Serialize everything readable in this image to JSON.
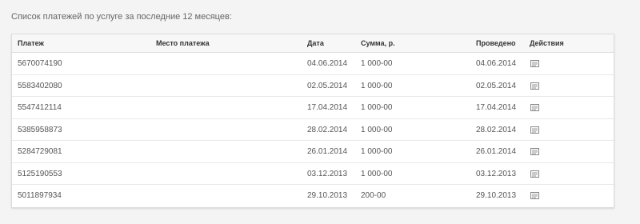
{
  "caption": "Список платежей по услуге за последние 12 месяцев:",
  "table": {
    "headers": {
      "payment": "Платеж",
      "place": "Место платежа",
      "date": "Дата",
      "sum": "Сумма, р.",
      "done": "Проведено",
      "actions": "Действия"
    },
    "rows": [
      {
        "payment": "5670074190",
        "place": "",
        "date": "04.06.2014",
        "sum": "1 000-00",
        "done": "04.06.2014",
        "action_icon": "receipt-icon"
      },
      {
        "payment": "5583402080",
        "place": "",
        "date": "02.05.2014",
        "sum": "1 000-00",
        "done": "02.05.2014",
        "action_icon": "receipt-icon"
      },
      {
        "payment": "5547412114",
        "place": "",
        "date": "17.04.2014",
        "sum": "1 000-00",
        "done": "17.04.2014",
        "action_icon": "receipt-icon"
      },
      {
        "payment": "5385958873",
        "place": "",
        "date": "28.02.2014",
        "sum": "1 000-00",
        "done": "28.02.2014",
        "action_icon": "receipt-icon"
      },
      {
        "payment": "5284729081",
        "place": "",
        "date": "26.01.2014",
        "sum": "1 000-00",
        "done": "26.01.2014",
        "action_icon": "receipt-icon"
      },
      {
        "payment": "5125190553",
        "place": "",
        "date": "03.12.2013",
        "sum": "1 000-00",
        "done": "03.12.2013",
        "action_icon": "receipt-icon"
      },
      {
        "payment": "5011897934",
        "place": "",
        "date": "29.10.2013",
        "sum": "200-00",
        "done": "29.10.2013",
        "action_icon": "receipt-icon"
      }
    ]
  },
  "colors": {
    "background": "#f4f4f4",
    "panel": "#ffffff",
    "header_bg": "#f7f7f7",
    "border": "#dcdcdc",
    "icon": "#888888"
  }
}
